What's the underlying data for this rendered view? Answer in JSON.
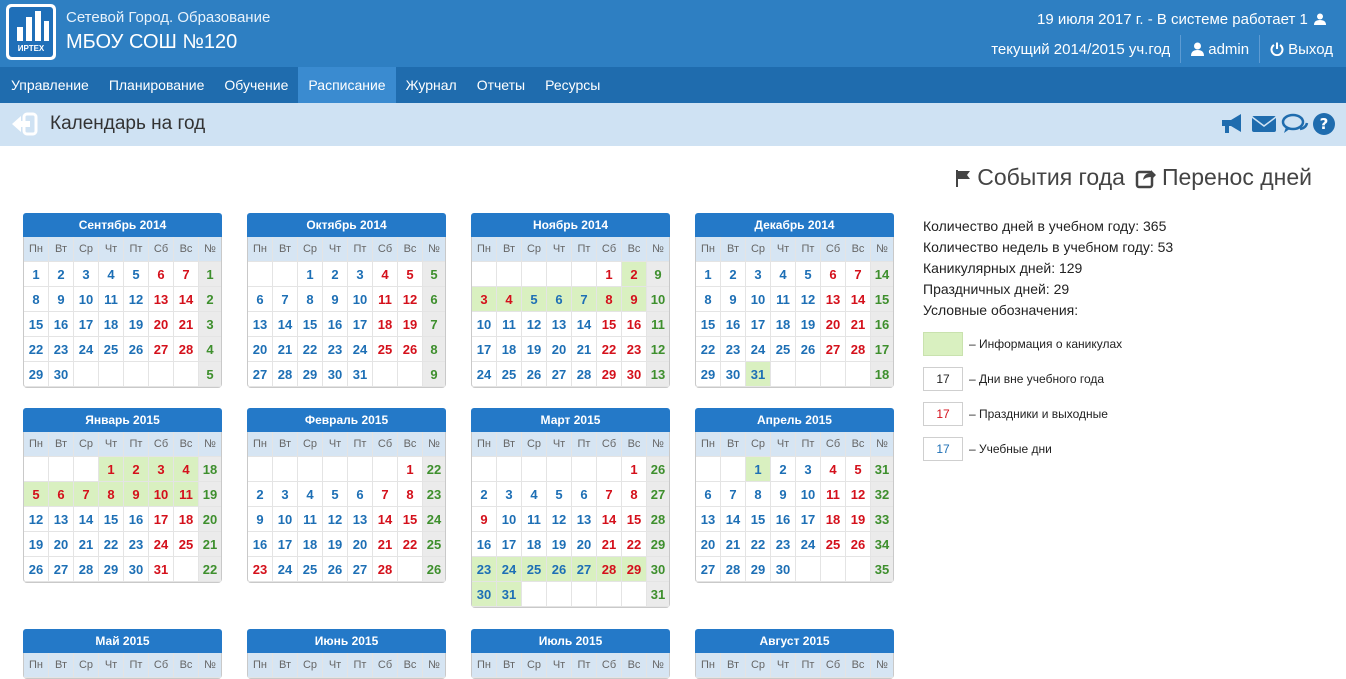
{
  "header": {
    "system_name": "Сетевой Город. Образование",
    "school_name": "МБОУ СОШ №120",
    "status": "19 июля 2017 г. - В системе работает 1",
    "school_year": "текущий 2014/2015 уч.год",
    "user": "admin",
    "logout": "Выход",
    "logo_text": "ИРТЕХ"
  },
  "nav": [
    "Управление",
    "Планирование",
    "Обучение",
    "Расписание",
    "Журнал",
    "Отчеты",
    "Ресурсы"
  ],
  "nav_active": 3,
  "page_title": "Календарь на год",
  "links": {
    "events": "События года",
    "transfer": "Перенос дней"
  },
  "weekday_headers": [
    "Пн",
    "Вт",
    "Ср",
    "Чт",
    "Пт",
    "Сб",
    "Вс",
    "№"
  ],
  "stats": [
    "Количество дней в учебном году: 365",
    "Количество недель в учебном году: 53",
    "Каникулярных дней: 129",
    "Праздничных дней: 29",
    "Условные обозначения:"
  ],
  "legend": [
    {
      "sample": "",
      "label": "– Информация о каникулах",
      "kind": "holiday"
    },
    {
      "sample": "17",
      "label": "– Дни вне учебного года",
      "kind": "outside"
    },
    {
      "sample": "17",
      "label": "– Праздники и выходные",
      "kind": "red"
    },
    {
      "sample": "17",
      "label": "– Учебные дни",
      "kind": "school"
    }
  ],
  "colors": {
    "header": "#2e7fc2",
    "nav": "#1f6cae",
    "nav_active": "#3a8bd0",
    "subbar": "#cfe2f3",
    "month_header": "#2479c8",
    "holiday_bg": "#d9f0c0",
    "red": "#d4101b",
    "blue": "#1d6fb5",
    "week_green": "#3e8f2d"
  },
  "icons": [
    "back-arrow-icon",
    "announcement-icon",
    "mail-icon",
    "chat-icon",
    "help-icon",
    "flag-icon",
    "share-icon",
    "user-icon",
    "power-icon"
  ],
  "months": [
    {
      "name": "Сентябрь 2014",
      "weeks": [
        [
          "1",
          "2",
          "3",
          "4",
          "5",
          "6",
          "7",
          "1"
        ],
        [
          "8",
          "9",
          "10",
          "11",
          "12",
          "13",
          "14",
          "2"
        ],
        [
          "15",
          "16",
          "17",
          "18",
          "19",
          "20",
          "21",
          "3"
        ],
        [
          "22",
          "23",
          "24",
          "25",
          "26",
          "27",
          "28",
          "4"
        ],
        [
          "29",
          "30",
          "",
          "",
          "",
          "",
          "",
          "5"
        ]
      ],
      "holidays": []
    },
    {
      "name": "Октябрь 2014",
      "weeks": [
        [
          "",
          "",
          "1",
          "2",
          "3",
          "4",
          "5",
          "5"
        ],
        [
          "6",
          "7",
          "8",
          "9",
          "10",
          "11",
          "12",
          "6"
        ],
        [
          "13",
          "14",
          "15",
          "16",
          "17",
          "18",
          "19",
          "7"
        ],
        [
          "20",
          "21",
          "22",
          "23",
          "24",
          "25",
          "26",
          "8"
        ],
        [
          "27",
          "28",
          "29",
          "30",
          "31",
          "",
          "",
          "9"
        ]
      ],
      "holidays": []
    },
    {
      "name": "Ноябрь 2014",
      "weeks": [
        [
          "",
          "",
          "",
          "",
          "",
          "1",
          "2",
          "9"
        ],
        [
          "3",
          "4",
          "5",
          "6",
          "7",
          "8",
          "9",
          "10"
        ],
        [
          "10",
          "11",
          "12",
          "13",
          "14",
          "15",
          "16",
          "11"
        ],
        [
          "17",
          "18",
          "19",
          "20",
          "21",
          "22",
          "23",
          "12"
        ],
        [
          "24",
          "25",
          "26",
          "27",
          "28",
          "29",
          "30",
          "13"
        ]
      ],
      "holidays": [
        "2",
        "3",
        "4",
        "5",
        "6",
        "7",
        "8",
        "9"
      ],
      "red": [
        "3",
        "4"
      ]
    },
    {
      "name": "Декабрь 2014",
      "weeks": [
        [
          "1",
          "2",
          "3",
          "4",
          "5",
          "6",
          "7",
          "14"
        ],
        [
          "8",
          "9",
          "10",
          "11",
          "12",
          "13",
          "14",
          "15"
        ],
        [
          "15",
          "16",
          "17",
          "18",
          "19",
          "20",
          "21",
          "16"
        ],
        [
          "22",
          "23",
          "24",
          "25",
          "26",
          "27",
          "28",
          "17"
        ],
        [
          "29",
          "30",
          "31",
          "",
          "",
          "",
          "",
          "18"
        ]
      ],
      "holidays": [
        "31"
      ]
    },
    {
      "name": "Январь 2015",
      "weeks": [
        [
          "",
          "",
          "",
          "1",
          "2",
          "3",
          "4",
          "18"
        ],
        [
          "5",
          "6",
          "7",
          "8",
          "9",
          "10",
          "11",
          "19"
        ],
        [
          "12",
          "13",
          "14",
          "15",
          "16",
          "17",
          "18",
          "20"
        ],
        [
          "19",
          "20",
          "21",
          "22",
          "23",
          "24",
          "25",
          "21"
        ],
        [
          "26",
          "27",
          "28",
          "29",
          "30",
          "31",
          "",
          "22"
        ]
      ],
      "holidays": [
        "1",
        "2",
        "3",
        "4",
        "5",
        "6",
        "7",
        "8",
        "9",
        "10",
        "11"
      ],
      "red": [
        "1",
        "2",
        "5",
        "6",
        "7",
        "8",
        "9"
      ]
    },
    {
      "name": "Февраль 2015",
      "weeks": [
        [
          "",
          "",
          "",
          "",
          "",
          "",
          "1",
          "22"
        ],
        [
          "2",
          "3",
          "4",
          "5",
          "6",
          "7",
          "8",
          "23"
        ],
        [
          "9",
          "10",
          "11",
          "12",
          "13",
          "14",
          "15",
          "24"
        ],
        [
          "16",
          "17",
          "18",
          "19",
          "20",
          "21",
          "22",
          "25"
        ],
        [
          "23",
          "24",
          "25",
          "26",
          "27",
          "28",
          "",
          "26"
        ]
      ],
      "holidays": [],
      "red": [
        "23"
      ]
    },
    {
      "name": "Март 2015",
      "weeks": [
        [
          "",
          "",
          "",
          "",
          "",
          "",
          "1",
          "26"
        ],
        [
          "2",
          "3",
          "4",
          "5",
          "6",
          "7",
          "8",
          "27"
        ],
        [
          "9",
          "10",
          "11",
          "12",
          "13",
          "14",
          "15",
          "28"
        ],
        [
          "16",
          "17",
          "18",
          "19",
          "20",
          "21",
          "22",
          "29"
        ],
        [
          "23",
          "24",
          "25",
          "26",
          "27",
          "28",
          "29",
          "30"
        ],
        [
          "30",
          "31",
          "",
          "",
          "",
          "",
          "",
          "31"
        ]
      ],
      "holidays": [
        "23",
        "24",
        "25",
        "26",
        "27",
        "28",
        "29",
        "30",
        "31"
      ],
      "red": [
        "9"
      ]
    },
    {
      "name": "Апрель 2015",
      "weeks": [
        [
          "",
          "",
          "1",
          "2",
          "3",
          "4",
          "5",
          "31"
        ],
        [
          "6",
          "7",
          "8",
          "9",
          "10",
          "11",
          "12",
          "32"
        ],
        [
          "13",
          "14",
          "15",
          "16",
          "17",
          "18",
          "19",
          "33"
        ],
        [
          "20",
          "21",
          "22",
          "23",
          "24",
          "25",
          "26",
          "34"
        ],
        [
          "27",
          "28",
          "29",
          "30",
          "",
          "",
          "",
          "35"
        ]
      ],
      "holidays": [
        "1"
      ]
    },
    {
      "name": "Май 2015",
      "weeks": [],
      "holidays": []
    },
    {
      "name": "Июнь 2015",
      "weeks": [],
      "holidays": []
    },
    {
      "name": "Июль 2015",
      "weeks": [],
      "holidays": []
    },
    {
      "name": "Август 2015",
      "weeks": [],
      "holidays": []
    }
  ]
}
